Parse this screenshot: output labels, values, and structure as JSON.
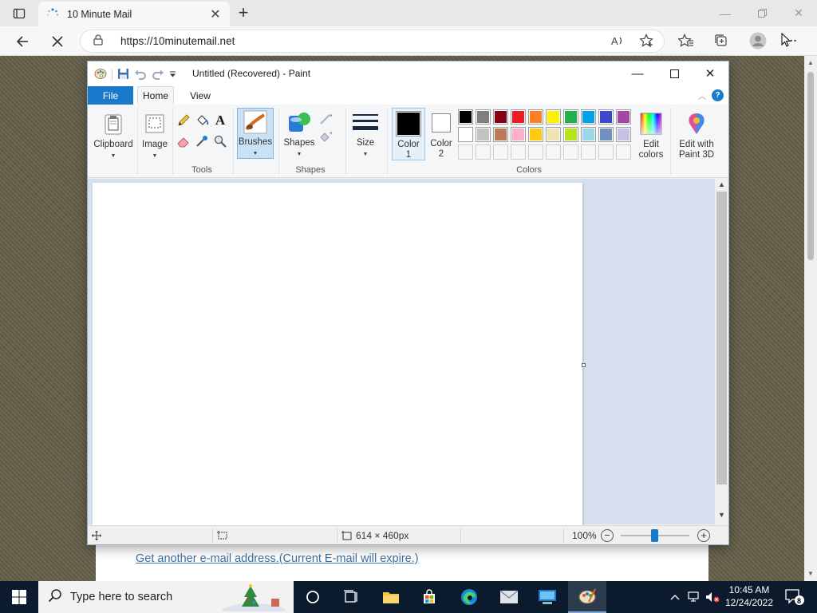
{
  "browser": {
    "tab_title": "10 Minute Mail",
    "tab_close": "✕",
    "new_tab": "+",
    "url": "https://10minutemail.net",
    "more": "···"
  },
  "webpage": {
    "link_text": "Get another e-mail address.(Current E-mail will expire.)"
  },
  "paint": {
    "window_title": "Untitled (Recovered) - Paint",
    "tabs": {
      "file": "File",
      "home": "Home",
      "view": "View"
    },
    "help": "?",
    "ribbon": {
      "clipboard": "Clipboard",
      "image": "Image",
      "tools_group": "Tools",
      "brushes": "Brushes",
      "shapes": "Shapes",
      "shapes_group": "Shapes",
      "size": "Size",
      "color1_line1": "Color",
      "color1_line2": "1",
      "color2_line1": "Color",
      "color2_line2": "2",
      "edit_colors_line1": "Edit",
      "edit_colors_line2": "colors",
      "colors_group": "Colors",
      "paint3d_line1": "Edit with",
      "paint3d_line2": "Paint 3D"
    },
    "palette_row1": [
      "#000000",
      "#7f7f7f",
      "#880015",
      "#ed1c24",
      "#ff7f27",
      "#fff200",
      "#22b14c",
      "#00a2e8",
      "#3f48cc",
      "#a349a4"
    ],
    "palette_row2": [
      "#ffffff",
      "#c3c3c3",
      "#b97a57",
      "#ffaec9",
      "#ffc90e",
      "#efe4b0",
      "#b5e61d",
      "#99d9ea",
      "#7092be",
      "#c8bfe7"
    ],
    "palette_row3_count": 10,
    "status": {
      "canvas_size": "614 × 460px",
      "zoom": "100%"
    }
  },
  "taskbar": {
    "search_placeholder": "Type here to search",
    "time": "10:45 AM",
    "date": "12/24/2022",
    "notif_count": "8"
  }
}
